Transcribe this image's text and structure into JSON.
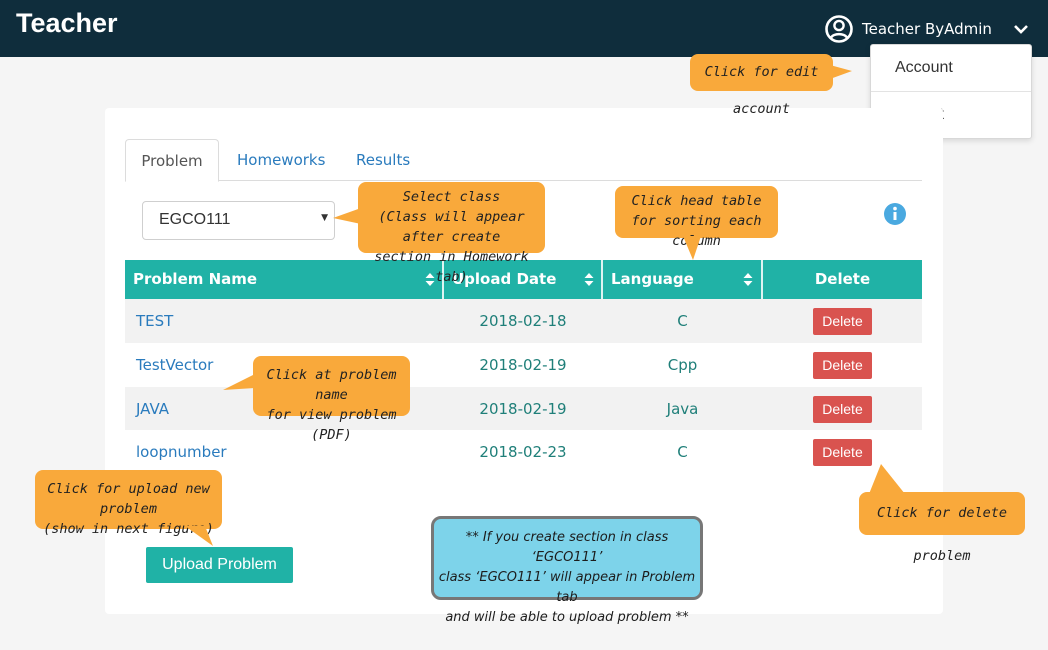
{
  "app": {
    "brand": "Teacher"
  },
  "user": {
    "name": "Teacher ByAdmin"
  },
  "dropdown": {
    "account": "Account",
    "logout": "Logout"
  },
  "tabs": [
    {
      "label": "Problem",
      "active": true
    },
    {
      "label": "Homeworks",
      "active": false
    },
    {
      "label": "Results",
      "active": false
    }
  ],
  "class_select": {
    "value": "EGCO111"
  },
  "table": {
    "headers": {
      "name": "Problem Name",
      "date": "Upload Date",
      "language": "Language",
      "delete": "Delete"
    },
    "rows": [
      {
        "name": "TEST",
        "date": "2018-02-18",
        "language": "C",
        "action": "Delete"
      },
      {
        "name": "TestVector",
        "date": "2018-02-19",
        "language": "Cpp",
        "action": "Delete"
      },
      {
        "name": "JAVA",
        "date": "2018-02-19",
        "language": "Java",
        "action": "Delete"
      },
      {
        "name": "loopnumber",
        "date": "2018-02-23",
        "language": "C",
        "action": "Delete"
      }
    ]
  },
  "upload_button": "Upload Problem",
  "callouts": {
    "edit_account": "Click for edit account",
    "select_class_1": "Select class",
    "select_class_2": "(Class will appear after create",
    "select_class_3": "section in Homework tab)",
    "sort_1": "Click head table",
    "sort_2": "for sorting each column",
    "problem_name_1": "Click at problem name",
    "problem_name_2": "for view problem (PDF)",
    "upload_1": "Click for upload new problem",
    "upload_2": "(show in next figure)",
    "delete": "Click for delete problem",
    "note_1": "** If you create section in class ‘EGCO111’",
    "note_2": "class ‘EGCO111’ will appear in Problem tab",
    "note_3": "and will be able to upload problem **"
  },
  "colors": {
    "navbar": "#0f2d3c",
    "accent": "#20b2a6",
    "danger": "#d9534f",
    "callout": "#f9a93b",
    "note": "#7dd3ea",
    "link": "#2a7bbd"
  },
  "icons": {
    "user": "user-circle-icon",
    "caret": "chevron-down-icon",
    "info": "info-circle-icon",
    "sort": "sort-icon"
  }
}
